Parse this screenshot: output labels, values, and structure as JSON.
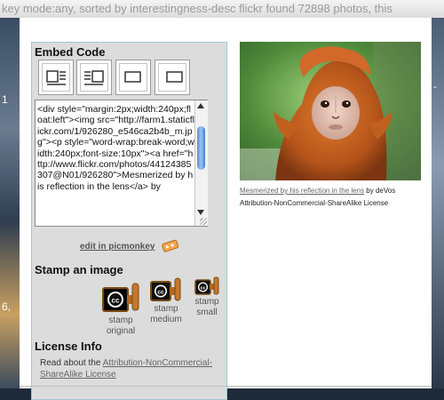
{
  "background": {
    "strip_text": "key mode:any, sorted by interestingness-desc flickr found 72898 photos, this",
    "left_digit_1": "1",
    "left_digit_2": "6,",
    "right_digit": "-"
  },
  "embed": {
    "title": "Embed Code",
    "layout_buttons": [
      "align-left-wrap-icon",
      "align-right-wrap-icon",
      "align-left-icon",
      "align-right-icon"
    ],
    "code": "<div style=\"margin:2px;width:240px;float:left\"><img src=\"http://farm1.staticflickr.com/1/926280_e546ca2b4b_m.jpg\"><p style=\"word-wrap:break-word;width:240px;font-size:10px\"><a href=\"http://www.flickr.com/photos/44124385307@N01/926280\">Mesmerized by his reflection in the lens</a> by"
  },
  "picmonkey": {
    "label": "edit in picmonkey"
  },
  "stamp": {
    "title": "Stamp an image",
    "items": [
      {
        "label_line1": "stamp",
        "label_line2": "original"
      },
      {
        "label_line1": "stamp",
        "label_line2": "medium"
      },
      {
        "label_line1": "stamp",
        "label_line2": "small"
      }
    ]
  },
  "license": {
    "title": "License Info",
    "prefix": "Read about the ",
    "link": "Attribution-NonCommercial-ShareAlike License"
  },
  "photo": {
    "caption_link": "Mesmerized by his reflection in the lens",
    "caption_by": " by deVos",
    "license_line": "Attribution-NonCommercial-ShareAlike License"
  },
  "colors": {
    "panel_bg": "#dcdcdc",
    "panel_border": "#9ec8d8",
    "monkey_fur": "#c4621f"
  }
}
